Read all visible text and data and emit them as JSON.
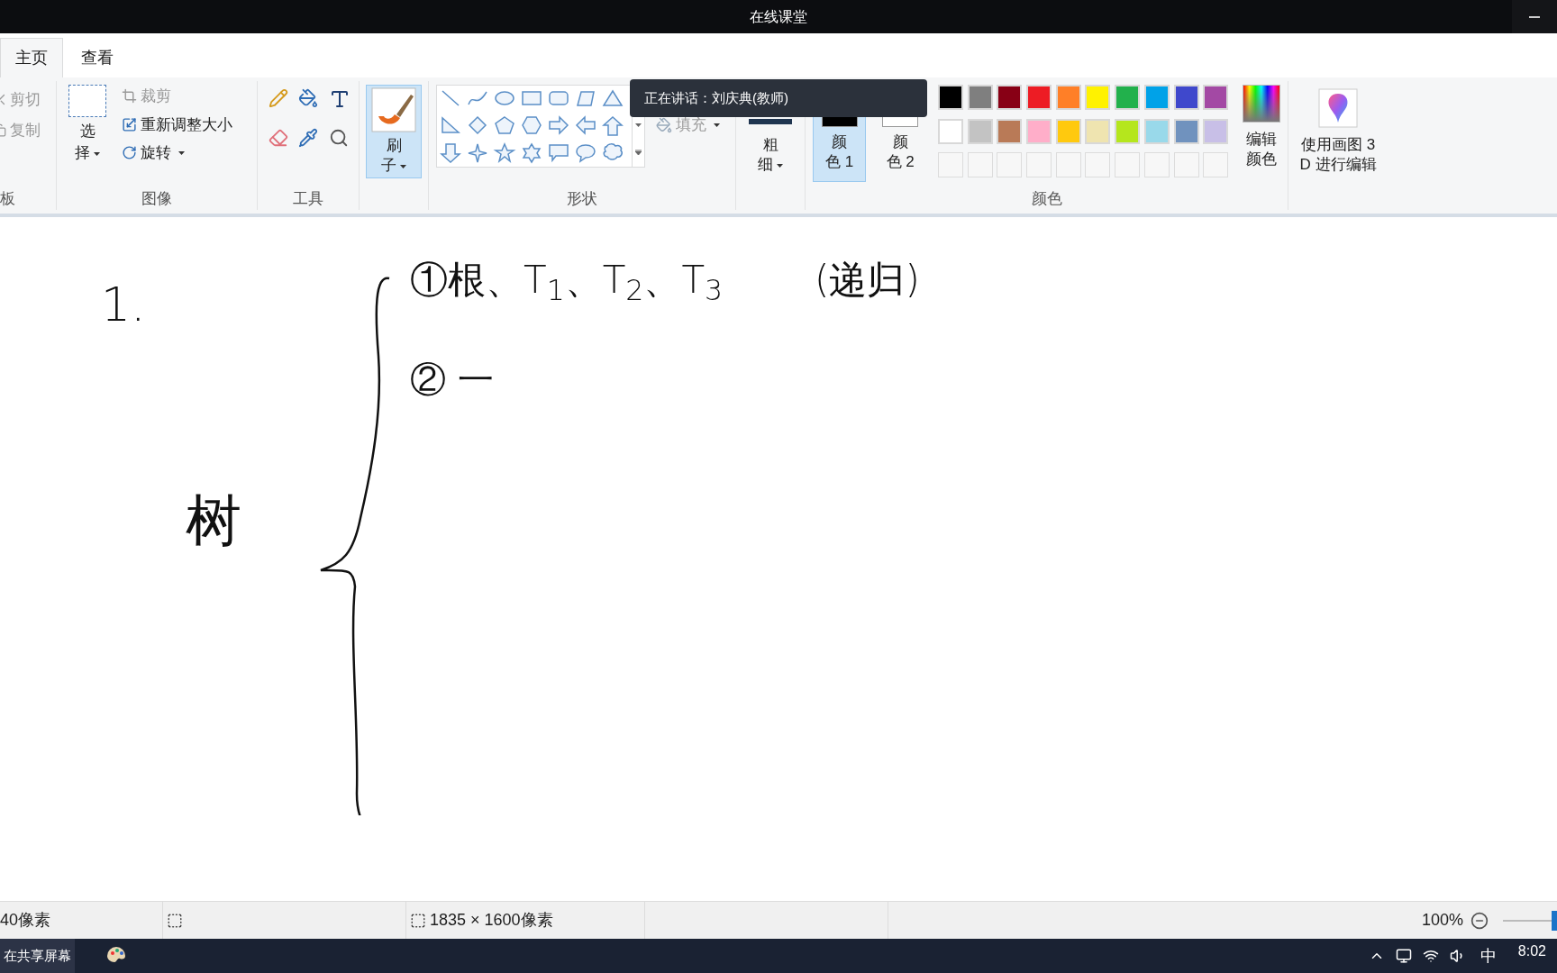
{
  "app_title": "在线课堂",
  "speaker_tooltip": "正在讲话：刘庆典(教师)",
  "tabs": [
    {
      "label": "主页",
      "selected": true
    },
    {
      "label": "查看",
      "selected": false
    }
  ],
  "ribbon": {
    "clipboard": {
      "items": [
        {
          "label": "剪切",
          "disabled": true
        },
        {
          "label": "复制",
          "disabled": true
        }
      ],
      "label": "板"
    },
    "image": {
      "select": [
        "选",
        "择"
      ],
      "items": [
        {
          "label": "裁剪",
          "disabled": true
        },
        {
          "label": "重新调整大小",
          "disabled": false
        },
        {
          "label": "旋转",
          "disabled": false
        }
      ],
      "label": "图像"
    },
    "tools": {
      "label": "工具"
    },
    "brush": {
      "label": [
        "刷",
        "子"
      ],
      "selected": true
    },
    "shapes": {
      "fill": "填充",
      "label": "形状"
    },
    "size": {
      "label": [
        "粗",
        "细"
      ]
    },
    "colors": {
      "slots": [
        {
          "label": [
            "颜",
            "色 1"
          ],
          "selected": true
        },
        {
          "label": [
            "颜",
            "色 2"
          ],
          "selected": false
        }
      ],
      "palette": [
        {
          "kind": "swatch",
          "color": "#000000"
        },
        {
          "kind": "swatch",
          "color": "#7f7f7f"
        },
        {
          "kind": "swatch",
          "color": "#880015"
        },
        {
          "kind": "swatch",
          "color": "#ed1c24"
        },
        {
          "kind": "swatch",
          "color": "#ff7f27"
        },
        {
          "kind": "swatch",
          "color": "#fff200"
        },
        {
          "kind": "swatch",
          "color": "#22b14c"
        },
        {
          "kind": "swatch",
          "color": "#00a2e8"
        },
        {
          "kind": "swatch",
          "color": "#3f48cc"
        },
        {
          "kind": "swatch",
          "color": "#a349a4"
        },
        {
          "kind": "swatch",
          "color": "#ffffff"
        },
        {
          "kind": "swatch",
          "color": "#c3c3c3"
        },
        {
          "kind": "swatch",
          "color": "#b97a57"
        },
        {
          "kind": "swatch",
          "color": "#ffaec9"
        },
        {
          "kind": "swatch",
          "color": "#ffc90e"
        },
        {
          "kind": "swatch",
          "color": "#efe4b0"
        },
        {
          "kind": "swatch",
          "color": "#b5e61d"
        },
        {
          "kind": "swatch",
          "color": "#99d9ea"
        },
        {
          "kind": "swatch",
          "color": "#7092be"
        },
        {
          "kind": "swatch",
          "color": "#c8bfe7"
        },
        {
          "kind": "empty"
        },
        {
          "kind": "empty"
        },
        {
          "kind": "empty"
        },
        {
          "kind": "empty"
        },
        {
          "kind": "empty"
        },
        {
          "kind": "empty"
        },
        {
          "kind": "empty"
        },
        {
          "kind": "empty"
        },
        {
          "kind": "empty"
        },
        {
          "kind": "empty"
        }
      ],
      "edit": [
        "编辑",
        "颜色"
      ],
      "label": "颜色"
    },
    "paint3d": [
      "使用画图 3",
      "D 进行编辑"
    ]
  },
  "canvas": {
    "notes": [
      {
        "text": "1."
      },
      {
        "text": "①根、T$_{1}$、T$_{2}$、T$_{3}$"
      },
      {
        "text": "(递归)"
      },
      {
        "text": "② 一"
      },
      {
        "text": "树"
      }
    ]
  },
  "status_bar": {
    "pen_size": "40像素",
    "image_size": "1835 × 1600像素",
    "zoom": "100%",
    "zoom_slider": {
      "level": 1
    }
  },
  "taskbar": {
    "sharing": "在共享屏幕",
    "ime": "中",
    "time": "8:02"
  }
}
